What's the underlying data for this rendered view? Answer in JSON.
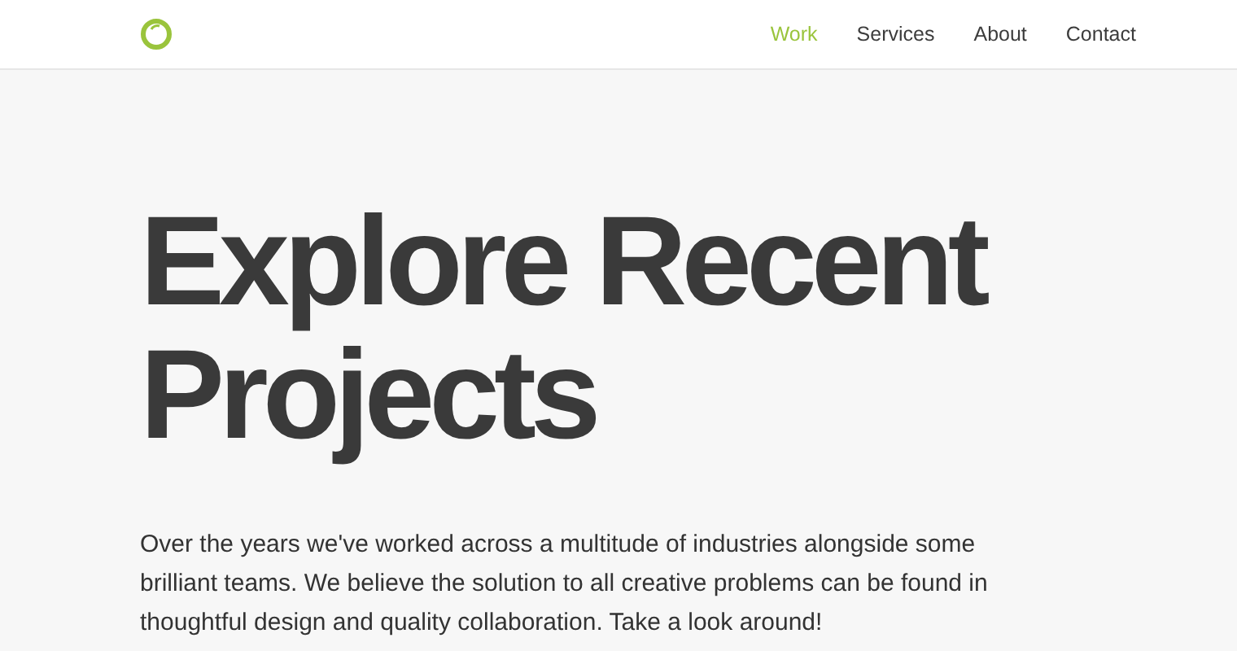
{
  "nav": [
    {
      "label": "Work",
      "selected": true
    },
    {
      "label": "Services",
      "selected": false
    },
    {
      "label": "About",
      "selected": false
    },
    {
      "label": "Contact",
      "selected": false
    }
  ],
  "hero": {
    "title_lines": [
      "Explore Recent",
      "Projects"
    ],
    "intro": "Over the years we've worked across a multitude of industries alongside some brilliant teams. We believe the solution to all creative problems can be found in thoughtful design and quality collaboration. Take a look around!"
  }
}
